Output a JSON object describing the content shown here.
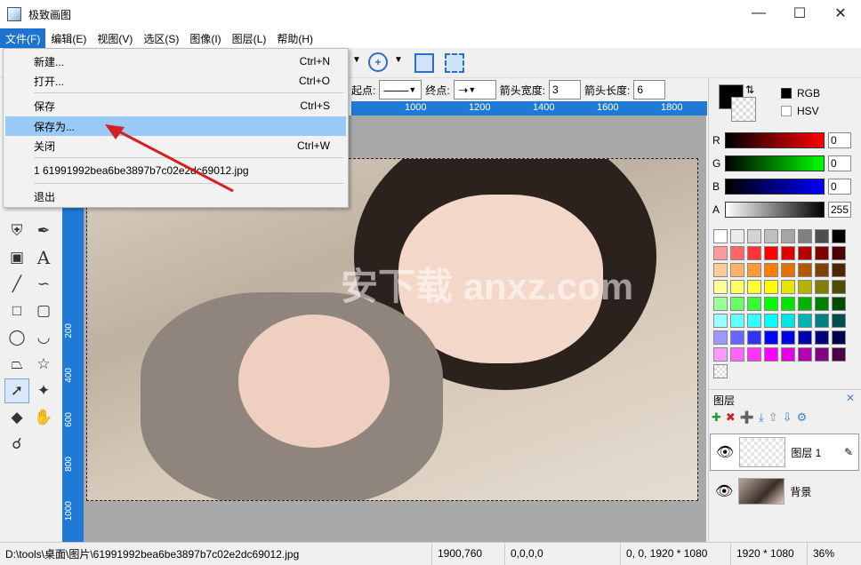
{
  "app": {
    "title": "极致画图"
  },
  "menu": [
    "文件(F)",
    "编辑(E)",
    "视图(V)",
    "选区(S)",
    "图像(I)",
    "图层(L)",
    "帮助(H)"
  ],
  "file_menu": {
    "new": "新建...",
    "new_sc": "Ctrl+N",
    "open": "打开...",
    "open_sc": "Ctrl+O",
    "save": "保存",
    "save_sc": "Ctrl+S",
    "save_as": "保存为...",
    "close": "关闭",
    "close_sc": "Ctrl+W",
    "recent": "1 61991992bea6be3897b7c02e2dc69012.jpg",
    "exit": "退出"
  },
  "options": {
    "start_label": "起点:",
    "end_label": "终点:",
    "arrow_width_label": "箭头宽度:",
    "arrow_width": "3",
    "arrow_length_label": "箭头长度:",
    "arrow_length": "6"
  },
  "hruler": [
    "1000",
    "1200",
    "1400",
    "1600",
    "1800"
  ],
  "vruler": [
    "200",
    "400",
    "600",
    "800",
    "1000"
  ],
  "color": {
    "rgb": "RGB",
    "hsv": "HSV",
    "r_label": "R",
    "g_label": "G",
    "b_label": "B",
    "a_label": "A",
    "r": "0",
    "g": "0",
    "b": "0",
    "a": "255"
  },
  "palette": [
    "#ffffff",
    "#ebebeb",
    "#d4d4d4",
    "#bfbfbf",
    "#a6a6a6",
    "#7f7f7f",
    "#4d4d4d",
    "#000000",
    "#ff9999",
    "#ff6666",
    "#ff3333",
    "#ff0000",
    "#e00000",
    "#b30000",
    "#800000",
    "#4d0000",
    "#ffcc99",
    "#ffb366",
    "#ff9933",
    "#ff8000",
    "#e67300",
    "#b35900",
    "#804000",
    "#4d2600",
    "#ffff99",
    "#ffff66",
    "#ffff33",
    "#ffff00",
    "#e6e600",
    "#b3b300",
    "#808000",
    "#4d4d00",
    "#99ff99",
    "#66ff66",
    "#33ff33",
    "#00ff00",
    "#00e600",
    "#00b300",
    "#008000",
    "#004d00",
    "#99ffff",
    "#66ffff",
    "#33ffff",
    "#00ffff",
    "#00e6e6",
    "#00b3b3",
    "#008080",
    "#004d4d",
    "#9999ff",
    "#6666ff",
    "#3333ff",
    "#0000ff",
    "#0000e6",
    "#0000b3",
    "#000080",
    "#00004d",
    "#ff99ff",
    "#ff66ff",
    "#ff33ff",
    "#ff00ff",
    "#e600e6",
    "#b300b3",
    "#800080",
    "#4d004d"
  ],
  "layers": {
    "title": "图层",
    "items": [
      "图层 1",
      "背景"
    ]
  },
  "status": {
    "path": "D:\\tools\\桌面\\图片\\61991992bea6be3897b7c02e2dc69012.jpg",
    "coords": "1900,760",
    "color": "0,0,0,0",
    "selection": "0, 0, 1920 * 1080",
    "size": "1920 * 1080",
    "zoom": "36%"
  },
  "watermark": "安下载 anxz.com"
}
